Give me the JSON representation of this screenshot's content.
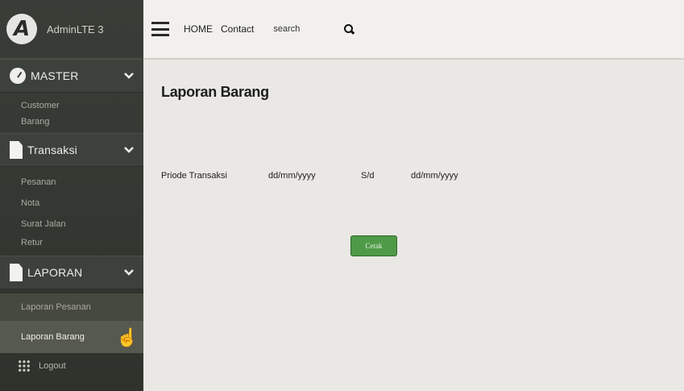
{
  "brand": {
    "logo_letter": "A",
    "name": "AdminLTE 3"
  },
  "topbar": {
    "nav": [
      "HOME",
      "Contact"
    ],
    "search_placeholder": "search"
  },
  "sidebar": {
    "master": {
      "label": "MASTER",
      "items": [
        "Customer",
        "Barang"
      ]
    },
    "transaksi": {
      "label": "Transaksi",
      "items": [
        "Pesanan",
        "Nota",
        "Surat Jalan",
        "Retur"
      ]
    },
    "laporan": {
      "label": "LAPORAN",
      "items": [
        "Laporan Pesanan",
        "Laporan Barang"
      ]
    },
    "logout": "Logout"
  },
  "main": {
    "title": "Laporan Barang",
    "period_label": "Priode Transaksi",
    "date_from": "dd/mm/yyyy",
    "separator": "S/d",
    "date_to": "dd/mm/yyyy",
    "button": "Cetak"
  }
}
